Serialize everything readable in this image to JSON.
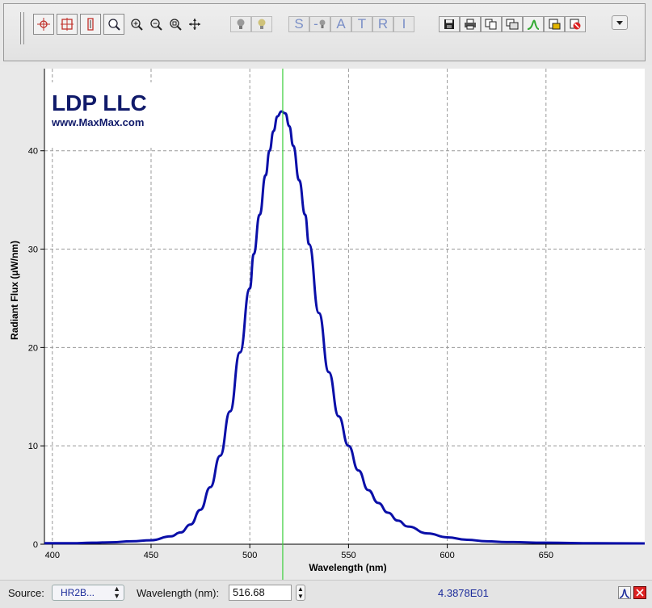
{
  "toolbar": {
    "tool_icons": [
      "crosshair-icon",
      "zoom-box-icon",
      "vertical-zoom-icon",
      "zoom-region-icon",
      "zoom-in-icon",
      "zoom-out-icon",
      "zoom-fit-icon",
      "pan-icon"
    ],
    "bulb_icons": [
      "bulb-off-icon",
      "bulb-on-icon"
    ],
    "mode_letters": [
      "S",
      "-",
      "A",
      "T",
      "R",
      "I"
    ],
    "file_icons": [
      "save-icon",
      "print-icon",
      "copy-icon",
      "copy-window-icon",
      "spectrum-icon",
      "export-icon",
      "clear-icon"
    ],
    "menu_icon": "dropdown-menu-icon"
  },
  "logo": {
    "name": "LDP LLC",
    "url": "www.MaxMax.com"
  },
  "colors": {
    "curve": "#0a0fa8",
    "cursor": "#3ccf3c",
    "grid": "#999999",
    "logo": "#101a6a"
  },
  "chart_data": {
    "type": "line",
    "xlabel": "Wavelength (nm)",
    "ylabel": "Radiant Flux (µW/nm)",
    "xlim": [
      396,
      700
    ],
    "ylim": [
      0,
      44
    ],
    "x_ticks": [
      "400",
      "450",
      "500",
      "550",
      "600",
      "650"
    ],
    "y_ticks": [
      "0",
      "10",
      "20",
      "30",
      "40"
    ],
    "grid": true,
    "cursor_x": 516.68,
    "series": [
      {
        "x": [
          396,
          410,
          420,
          430,
          440,
          450,
          460,
          465,
          470,
          475,
          480,
          485,
          490,
          495,
          500,
          502,
          505,
          508,
          510,
          512,
          514,
          516,
          518,
          520,
          522,
          525,
          528,
          530,
          535,
          540,
          545,
          550,
          555,
          560,
          565,
          570,
          575,
          580,
          590,
          600,
          610,
          620,
          630,
          650,
          675,
          700
        ],
        "y": [
          0.1,
          0.1,
          0.15,
          0.2,
          0.3,
          0.4,
          0.8,
          1.2,
          2.0,
          3.5,
          5.8,
          9.0,
          13.5,
          19.5,
          26.0,
          29.5,
          33.5,
          37.5,
          40.0,
          42.0,
          43.5,
          44.0,
          43.8,
          42.5,
          40.5,
          37.0,
          33.5,
          30.5,
          23.5,
          17.5,
          13.0,
          10.0,
          7.5,
          5.5,
          4.2,
          3.2,
          2.4,
          1.8,
          1.1,
          0.7,
          0.45,
          0.3,
          0.22,
          0.15,
          0.1,
          0.08
        ]
      }
    ]
  },
  "status": {
    "source_label": "Source:",
    "source_value": "HR2B...",
    "wavelength_label": "Wavelength (nm):",
    "wavelength_value": "516.68",
    "readout": "4.3878E01"
  }
}
